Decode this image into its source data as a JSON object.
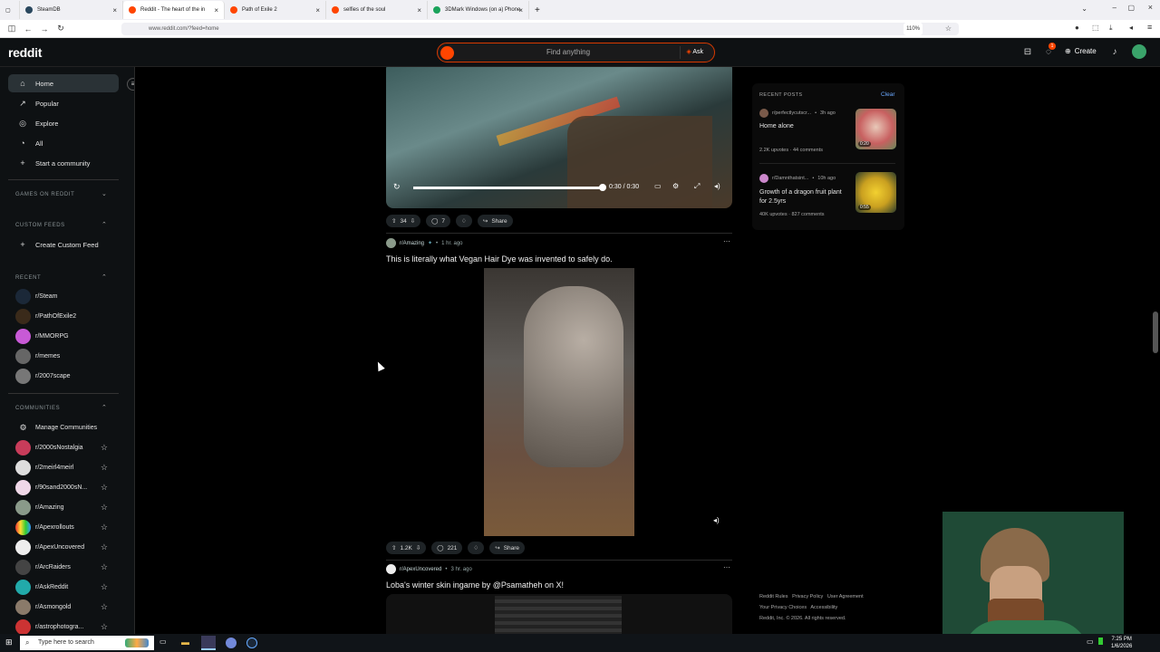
{
  "browser": {
    "tabs": [
      {
        "label": "SteamDB",
        "icon_color": "#2a475e"
      },
      {
        "label": "Reddit - The heart of the in",
        "icon_color": "#ff4500"
      },
      {
        "label": "Path of Exile 2",
        "icon_color": "#ff4500"
      },
      {
        "label": "selfies of the soul",
        "icon_color": "#ff4500"
      },
      {
        "label": "3DMark Windows (on a) Phone",
        "icon_color": "#1aa35b"
      }
    ],
    "new_tab": "+",
    "url": "www.reddit.com/?feed=home",
    "zoom": "110%"
  },
  "header": {
    "logo": "reddit",
    "search_placeholder": "Find anything",
    "ask": "Ask",
    "create": "Create",
    "notif_count": "1"
  },
  "sidebar": {
    "main": [
      {
        "label": "Home",
        "icon": "home-icon",
        "glyph": "⌂"
      },
      {
        "label": "Popular",
        "icon": "popular-icon",
        "glyph": "↗"
      },
      {
        "label": "Explore",
        "icon": "explore-icon",
        "glyph": "◎"
      },
      {
        "label": "All",
        "icon": "all-icon",
        "glyph": "◔"
      },
      {
        "label": "Start a community",
        "icon": "plus-icon",
        "glyph": "+"
      }
    ],
    "games_heading": "GAMES ON REDDIT",
    "custom_heading": "CUSTOM FEEDS",
    "create_custom": "Create Custom Feed",
    "recent_heading": "RECENT",
    "recent": [
      {
        "label": "r/Steam",
        "color": "#1b2838"
      },
      {
        "label": "r/PathOfExile2",
        "color": "#3a2a1a"
      },
      {
        "label": "r/MMORPG",
        "color": "#c85ad6"
      },
      {
        "label": "r/memes",
        "color": "#666"
      },
      {
        "label": "r/2007scape",
        "color": "#777"
      }
    ],
    "communities_heading": "COMMUNITIES",
    "manage": "Manage Communities",
    "communities": [
      {
        "label": "r/2000sNostalgia",
        "color": "#c83c5a"
      },
      {
        "label": "r/2meirl4meirl",
        "color": "#ddd"
      },
      {
        "label": "r/90sand2000sN...",
        "color": "#f0d8e8"
      },
      {
        "label": "r/Amazing",
        "color": "#8a9a8a"
      },
      {
        "label": "r/Apexrollouts",
        "color": "#e84"
      },
      {
        "label": "r/ApexUncovered",
        "color": "#eee"
      },
      {
        "label": "r/ArcRaiders",
        "color": "#444"
      },
      {
        "label": "r/AskReddit",
        "color": "#2aa"
      },
      {
        "label": "r/Asmongold",
        "color": "#8a7a6a"
      },
      {
        "label": "r/astrophotogra...",
        "color": "#c33"
      }
    ]
  },
  "posts": [
    {
      "video_time": "0:30 / 0:30",
      "votes": "34",
      "comments": "7",
      "share": "Share"
    },
    {
      "subreddit": "r/Amazing",
      "time": "1 hr. ago",
      "title": "This is literally what Vegan Hair Dye was invented to safely do.",
      "votes": "1.2K",
      "comments": "221",
      "share": "Share"
    },
    {
      "subreddit": "r/ApexUncovered",
      "time": "3 hr. ago",
      "title": "Loba's winter skin ingame by @Psamatheh on X!"
    }
  ],
  "recent_posts": {
    "heading": "RECENT POSTS",
    "clear": "Clear",
    "items": [
      {
        "sub": "r/perfectlycutscr...",
        "time": "3h ago",
        "title": "Home alone",
        "stats": "2.2K upvotes · 44 comments",
        "thumb_time": "0:20"
      },
      {
        "sub": "r/Damnthatsint...",
        "time": "10h ago",
        "title": "Growth of a dragon fruit plant for 2.5yrs",
        "stats": "40K upvotes · 827 comments",
        "thumb_time": "0:55"
      }
    ]
  },
  "footer": {
    "line1": "Reddit Rules   Privacy Policy   User Agreement",
    "line2": "Your Privacy Choices   Accessibility",
    "line3": "Reddit, Inc. © 2026. All rights reserved."
  },
  "taskbar": {
    "search": "Type here to search",
    "time": "7:25 PM",
    "date": "1/6/2026"
  }
}
